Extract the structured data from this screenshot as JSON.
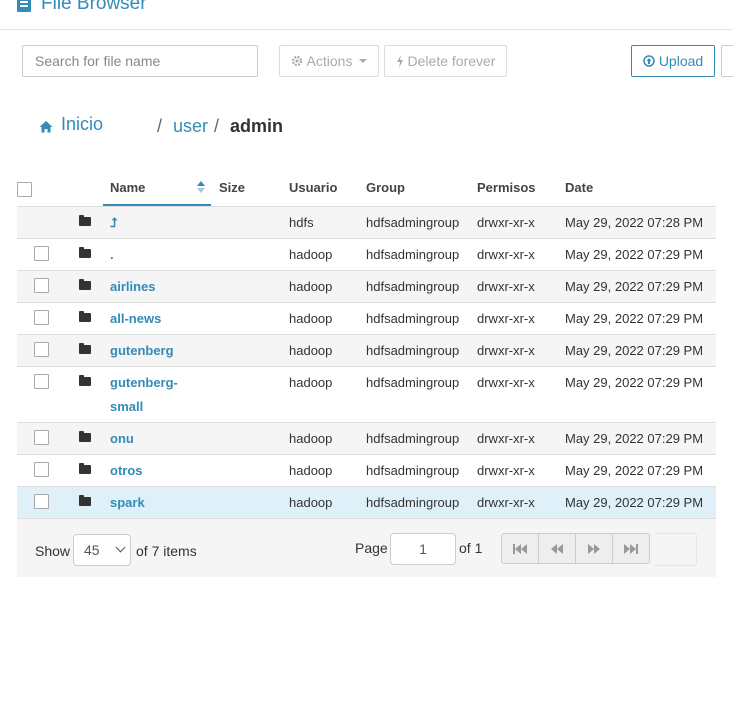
{
  "app": {
    "title": "File Browser"
  },
  "toolbar": {
    "search_placeholder": "Search for file name",
    "actions_label": "Actions",
    "delete_label": "Delete forever",
    "upload_label": "Upload"
  },
  "breadcrumb": {
    "home": "Inicio",
    "sep1": "/",
    "user": "user",
    "sep2": "/",
    "current": "admin"
  },
  "table": {
    "headers": {
      "name": "Name",
      "size": "Size",
      "user": "Usuario",
      "group": "Group",
      "perms": "Permisos",
      "date": "Date"
    },
    "sort": {
      "column": "Name",
      "direction": "ascending"
    },
    "rows": [
      {
        "name": "⮥",
        "size": "",
        "user": "hdfs",
        "group": "hdfsadmingroup",
        "perms": "drwxr-xr-x",
        "date": "May 29, 2022 07:28 PM"
      },
      {
        "name": ".",
        "size": "",
        "user": "hadoop",
        "group": "hdfsadmingroup",
        "perms": "drwxr-xr-x",
        "date": "May 29, 2022 07:29 PM"
      },
      {
        "name": "airlines",
        "size": "",
        "user": "hadoop",
        "group": "hdfsadmingroup",
        "perms": "drwxr-xr-x",
        "date": "May 29, 2022 07:29 PM"
      },
      {
        "name": "all-news",
        "size": "",
        "user": "hadoop",
        "group": "hdfsadmingroup",
        "perms": "drwxr-xr-x",
        "date": "May 29, 2022 07:29 PM"
      },
      {
        "name": "gutenberg",
        "size": "",
        "user": "hadoop",
        "group": "hdfsadmingroup",
        "perms": "drwxr-xr-x",
        "date": "May 29, 2022 07:29 PM"
      },
      {
        "name": "gutenberg-",
        "name2": "small",
        "size": "",
        "user": "hadoop",
        "group": "hdfsadmingroup",
        "perms": "drwxr-xr-x",
        "date": "May 29, 2022 07:29 PM"
      },
      {
        "name": "onu",
        "size": "",
        "user": "hadoop",
        "group": "hdfsadmingroup",
        "perms": "drwxr-xr-x",
        "date": "May 29, 2022 07:29 PM"
      },
      {
        "name": "otros",
        "size": "",
        "user": "hadoop",
        "group": "hdfsadmingroup",
        "perms": "drwxr-xr-x",
        "date": "May 29, 2022 07:29 PM"
      },
      {
        "name": "spark",
        "size": "",
        "user": "hadoop",
        "group": "hdfsadmingroup",
        "perms": "drwxr-xr-x",
        "date": "May 29, 2022 07:29 PM"
      }
    ]
  },
  "footer": {
    "show_label": "Show",
    "page_size": "45",
    "items_label": "of 7 items",
    "page_label": "Page",
    "page_value": "1",
    "of_label": "of 1"
  },
  "colors": {
    "accent": "#338bb8",
    "selected_row": "#dff0f8",
    "alt_row": "#f5f5f5"
  },
  "icons": [
    "file-icon",
    "gear-icon",
    "bolt-icon",
    "upload-icon",
    "home-icon",
    "folder-icon",
    "first-page-icon",
    "prev-page-icon",
    "next-page-icon",
    "last-page-icon"
  ]
}
